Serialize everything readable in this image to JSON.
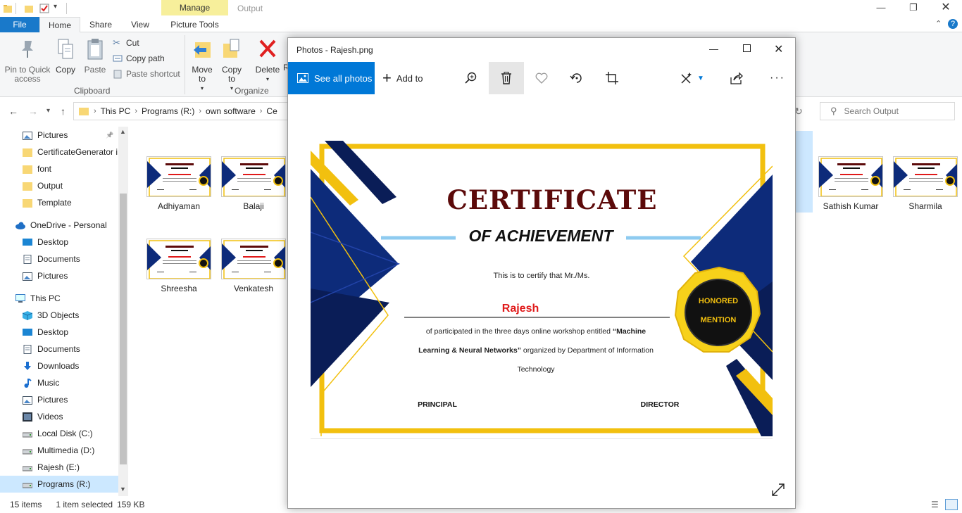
{
  "explorer": {
    "manage_tab": "Manage",
    "window_title": "Output",
    "tabs": {
      "file": "File",
      "home": "Home",
      "share": "Share",
      "view": "View",
      "picture_tools": "Picture Tools"
    },
    "ribbon": {
      "pin": "Pin to Quick access",
      "copy": "Copy",
      "paste": "Paste",
      "cut": "Cut",
      "copy_path": "Copy path",
      "paste_shortcut": "Paste shortcut",
      "clipboard_group": "Clipboard",
      "move_to": "Move to",
      "copy_to": "Copy to",
      "delete": "Delete",
      "rename_partial": "R",
      "organize_group": "Organize"
    },
    "breadcrumb": [
      "This PC",
      "Programs (R:)",
      "own software",
      "Ce"
    ],
    "search_placeholder": "Search Output",
    "nav": [
      {
        "label": "Pictures",
        "icon": "pictures-folder-icon"
      },
      {
        "label": "CertificateGenerator i",
        "icon": "folder-icon"
      },
      {
        "label": "font",
        "icon": "folder-icon"
      },
      {
        "label": "Output",
        "icon": "folder-icon"
      },
      {
        "label": "Template",
        "icon": "folder-icon"
      },
      {
        "label": "OneDrive - Personal",
        "icon": "cloud-icon"
      },
      {
        "label": "Desktop",
        "icon": "desktop-icon"
      },
      {
        "label": "Documents",
        "icon": "documents-icon"
      },
      {
        "label": "Pictures",
        "icon": "pictures-folder-icon"
      },
      {
        "label": "This PC",
        "icon": "computer-icon"
      },
      {
        "label": "3D Objects",
        "icon": "cube-icon"
      },
      {
        "label": "Desktop",
        "icon": "desktop-icon"
      },
      {
        "label": "Documents",
        "icon": "documents-icon"
      },
      {
        "label": "Downloads",
        "icon": "download-icon"
      },
      {
        "label": "Music",
        "icon": "music-icon"
      },
      {
        "label": "Pictures",
        "icon": "pictures-folder-icon"
      },
      {
        "label": "Videos",
        "icon": "videos-icon"
      },
      {
        "label": "Local Disk (C:)",
        "icon": "drive-icon"
      },
      {
        "label": "Multimedia (D:)",
        "icon": "drive-icon"
      },
      {
        "label": "Rajesh (E:)",
        "icon": "drive-icon"
      },
      {
        "label": "Programs (R:)",
        "icon": "drive-icon"
      }
    ],
    "files": [
      "Adhiyaman",
      "Balaji",
      "Shreesha",
      "Venkatesh",
      "Sathish Kumar",
      "Sharmila"
    ],
    "status": {
      "count": "15 items",
      "selected": "1 item selected",
      "size": "159 KB"
    }
  },
  "photos": {
    "title": "Photos - Rajesh.png",
    "see_all": "See all photos",
    "add_to": "Add to",
    "icons": [
      "zoom-icon",
      "delete-icon",
      "heart-icon",
      "rotate-icon",
      "crop-icon",
      "edit-icon",
      "share-icon",
      "more-icon"
    ]
  },
  "certificate": {
    "title": "CERTIFICATE",
    "subtitle": "OF ACHIEVEMENT",
    "certify": "This is to certify that Mr./Ms.",
    "name": "Rajesh",
    "body_1a": "of participated in the three days online workshop entitled ",
    "body_1b": "“Machine",
    "body_2a": "Learning & Neural Networks”",
    "body_2b": " organized by Department of Information",
    "body_3": "Technology",
    "seal_line1": "HONORED",
    "seal_line2": "MENTION",
    "sign_left": "PRINCIPAL",
    "sign_right": "DIRECTOR"
  },
  "colors": {
    "accent": "#0078d7",
    "navy": "#0d2b7a",
    "gold": "#f2c00f",
    "maroon": "#5c0a0a",
    "name_red": "#e01a1a"
  }
}
